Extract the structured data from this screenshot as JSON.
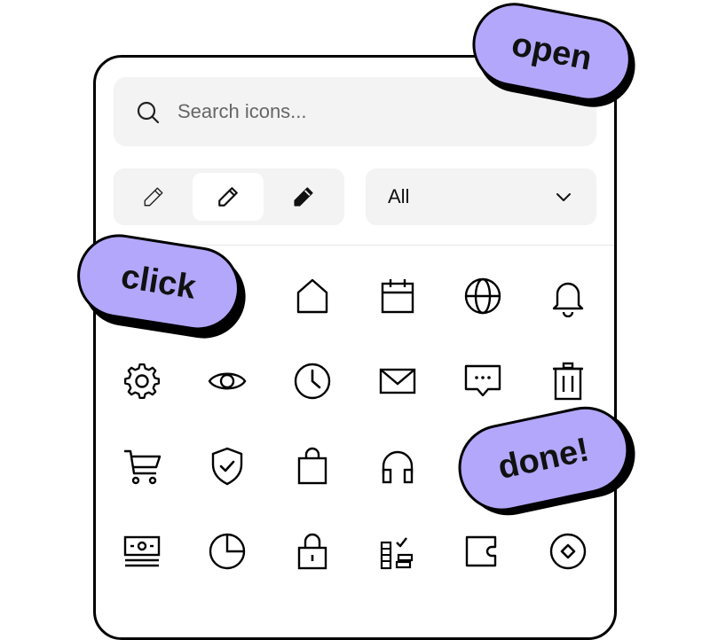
{
  "search": {
    "placeholder": "Search icons...",
    "value": ""
  },
  "style_toggle": {
    "options": [
      {
        "icon": "pencil-outline-icon"
      },
      {
        "icon": "pencil-icon",
        "selected": true
      },
      {
        "icon": "pencil-filled-icon"
      }
    ]
  },
  "filter": {
    "selected": "All"
  },
  "icons": [
    "placeholder",
    "home-icon",
    "calendar-icon",
    "globe-icon",
    "bell-icon",
    "gear-icon",
    "eye-icon",
    "clock-icon",
    "mail-icon",
    "chat-icon",
    "trash-icon",
    "cart-icon",
    "shield-check-icon",
    "bag-icon",
    "headphones-icon",
    "money-icon",
    "pie-chart-icon",
    "lock-icon",
    "checklist-icon",
    "wallet-icon",
    "diamond-coin-icon"
  ],
  "stickers": {
    "open": "open",
    "click": "click",
    "done": "done!"
  },
  "colors": {
    "sticker": "#b3a7fb",
    "input_bg": "#f3f3f3",
    "stroke": "#000000"
  }
}
